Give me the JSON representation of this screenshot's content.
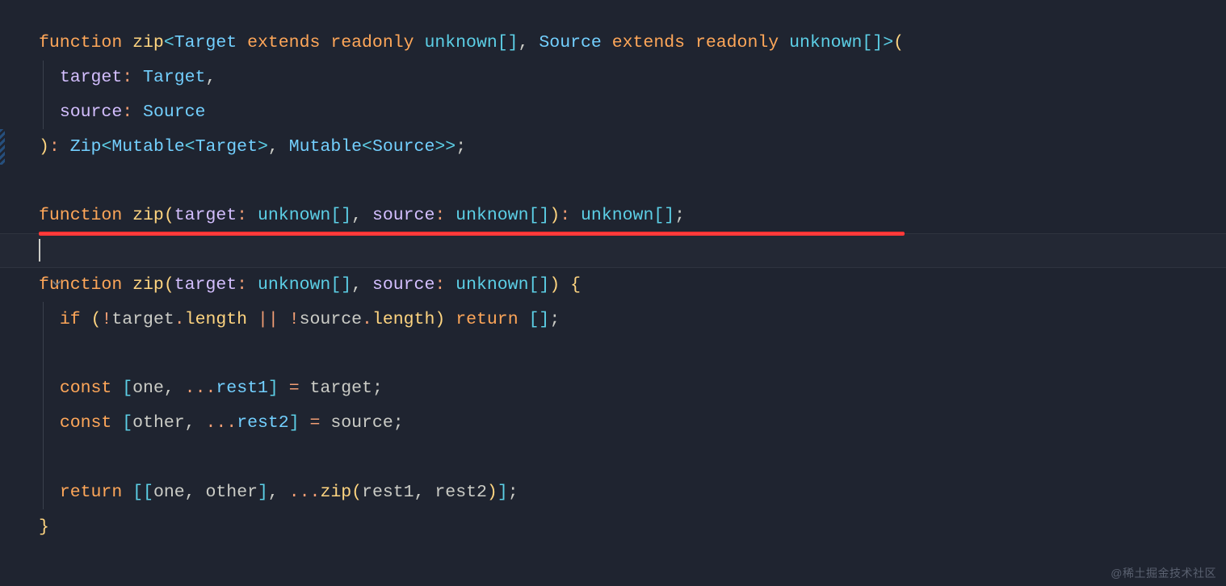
{
  "watermark": "@稀土掘金技术社区",
  "code": {
    "l1": {
      "kw_function": "function",
      "fn": "zip",
      "type_Target": "Target",
      "kw_extends1": "extends",
      "kw_readonly1": "readonly",
      "utype1": "unknown",
      "type_Source": "Source",
      "kw_extends2": "extends",
      "kw_readonly2": "readonly",
      "utype2": "unknown"
    },
    "l2": {
      "param": "target",
      "type": "Target"
    },
    "l3": {
      "param": "source",
      "type": "Source"
    },
    "l4": {
      "type_Zip": "Zip",
      "type_Mutable1": "Mutable",
      "type_Target": "Target",
      "type_Mutable2": "Mutable",
      "type_Source": "Source"
    },
    "l6": {
      "kw_function": "function",
      "fn": "zip",
      "param1": "target",
      "utype1": "unknown",
      "param2": "source",
      "utype2": "unknown",
      "utype3": "unknown"
    },
    "l8": {
      "kw_function": "function",
      "fn": "zip",
      "param1": "target",
      "utype1": "unknown",
      "param2": "source",
      "utype2": "unknown"
    },
    "l9": {
      "kw_if": "if",
      "target": "target",
      "length1": "length",
      "source": "source",
      "length2": "length",
      "kw_return": "return"
    },
    "l11": {
      "kw_const": "const",
      "one": "one",
      "rest1": "rest1",
      "target": "target"
    },
    "l12": {
      "kw_const": "const",
      "other": "other",
      "rest2": "rest2",
      "source": "source"
    },
    "l14": {
      "kw_return": "return",
      "one": "one",
      "other": "other",
      "fn": "zip",
      "rest1": "rest1",
      "rest2": "rest2"
    }
  }
}
